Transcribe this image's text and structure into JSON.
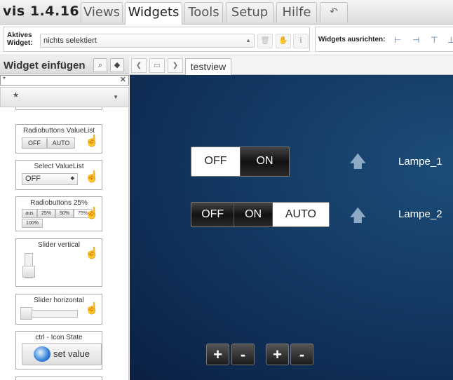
{
  "app": {
    "title": "vis 1.4.16"
  },
  "menu": {
    "tabs": [
      "Views",
      "Widgets",
      "Tools",
      "Setup",
      "Hilfe"
    ],
    "active": "Widgets"
  },
  "toolbar": {
    "active_widget_label": "Aktives Widget:",
    "active_widget_value": "nichts selektiert",
    "align_label": "Widgets ausrichten:"
  },
  "sidebar": {
    "title": "Widget einfügen",
    "filter_value": "*",
    "filter_clear": "✕",
    "widget_set": "*",
    "palette": [
      {
        "title": "Radiobuttons ValueList",
        "buttons": [
          "OFF",
          "AUTO"
        ]
      },
      {
        "title": "Select ValueList",
        "select_value": "OFF"
      },
      {
        "title": "Radiobuttons 25%",
        "buttons": [
          "aus",
          "25%",
          "50%",
          "75%",
          "100%"
        ]
      },
      {
        "title": "Slider vertical"
      },
      {
        "title": "Slider horizontal"
      },
      {
        "title": "ctrl - Icon State",
        "button_label": "set value"
      }
    ]
  },
  "views": {
    "active_tab": "testview"
  },
  "canvas": {
    "lamps": [
      {
        "name": "Lampe_1",
        "states": [
          "OFF",
          "ON"
        ],
        "selected": "OFF"
      },
      {
        "name": "Lampe_2",
        "states": [
          "OFF",
          "ON",
          "AUTO"
        ],
        "selected": "AUTO"
      }
    ],
    "buttons": [
      "+",
      "-",
      "+",
      "-"
    ]
  },
  "colors": {
    "canvas_dark": "#0b1f44",
    "canvas_light": "#1c4d78",
    "accent": "#4b78b5"
  },
  "icons": [
    "undo-icon",
    "trash-icon",
    "hand-icon",
    "info-icon",
    "search-icon",
    "tag-icon",
    "chevron-left-icon",
    "clipboard-icon",
    "chevron-right-icon",
    "bulb-icon"
  ]
}
